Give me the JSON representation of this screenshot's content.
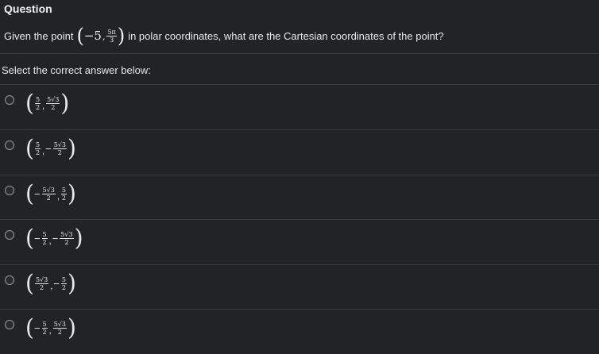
{
  "question": {
    "title": "Question",
    "text_before": "Given the point",
    "text_after": "in polar coordinates, what are the Cartesian coordinates of the point?",
    "point": {
      "r": "−5",
      "theta_num": "5π",
      "theta_den": "3"
    }
  },
  "select_label": "Select the correct answer below:",
  "options": [
    {
      "a_sign": "",
      "a_num": "5",
      "a_den": "2",
      "b_sign": "",
      "b_num": "5√3",
      "b_den": "2"
    },
    {
      "a_sign": "",
      "a_num": "5",
      "a_den": "2",
      "b_sign": "−",
      "b_num": "5√3",
      "b_den": "2"
    },
    {
      "a_sign": "−",
      "a_num": "5√3",
      "a_den": "2",
      "b_sign": "",
      "b_num": "5",
      "b_den": "2"
    },
    {
      "a_sign": "−",
      "a_num": "5",
      "a_den": "2",
      "b_sign": "−",
      "b_num": "5√3",
      "b_den": "2"
    },
    {
      "a_sign": "",
      "a_num": "5√3",
      "a_den": "2",
      "b_sign": "−",
      "b_num": "5",
      "b_den": "2"
    },
    {
      "a_sign": "−",
      "a_num": "5",
      "a_den": "2",
      "b_sign": "",
      "b_num": "5√3",
      "b_den": "2"
    }
  ],
  "separator": ","
}
